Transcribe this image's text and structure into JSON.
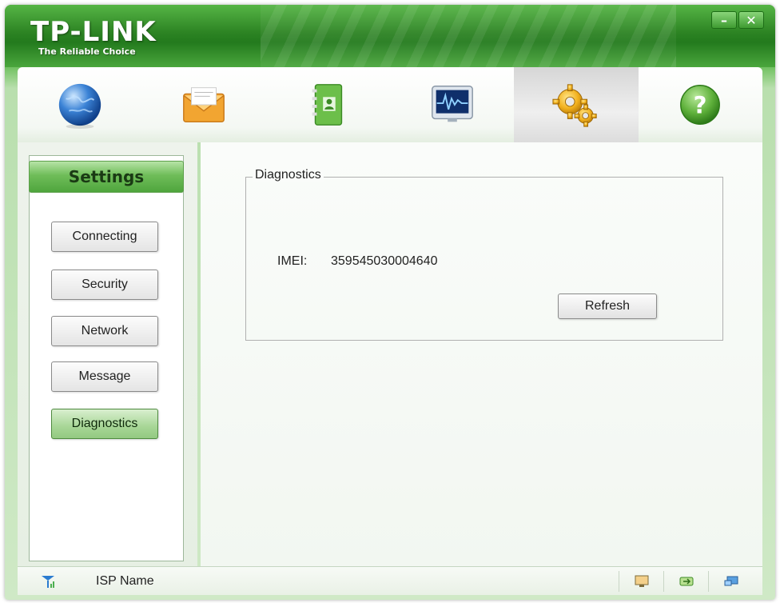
{
  "window": {
    "brand": "TP-LINK",
    "tagline": "The Reliable Choice",
    "minimize_label": "–",
    "close_label": "✕"
  },
  "toolbar": {
    "items": [
      {
        "icon": "globe-icon"
      },
      {
        "icon": "envelope-icon"
      },
      {
        "icon": "address-book-icon"
      },
      {
        "icon": "monitor-icon"
      },
      {
        "icon": "gears-icon",
        "active": true
      },
      {
        "icon": "help-icon"
      }
    ]
  },
  "sidebar": {
    "title": "Settings",
    "items": [
      {
        "label": "Connecting"
      },
      {
        "label": "Security"
      },
      {
        "label": "Network"
      },
      {
        "label": "Message"
      },
      {
        "label": "Diagnostics",
        "active": true
      }
    ]
  },
  "diagnostics": {
    "legend": "Diagnostics",
    "imei_label": "IMEI:",
    "imei_value": "359545030004640",
    "refresh_label": "Refresh"
  },
  "statusbar": {
    "isp_name": "ISP Name",
    "icons": [
      "signal-icon",
      "monitor-status-icon",
      "connection-icon",
      "network-icon"
    ]
  },
  "colors": {
    "brand_green": "#2f8a27",
    "active_button": "#a7d696"
  }
}
